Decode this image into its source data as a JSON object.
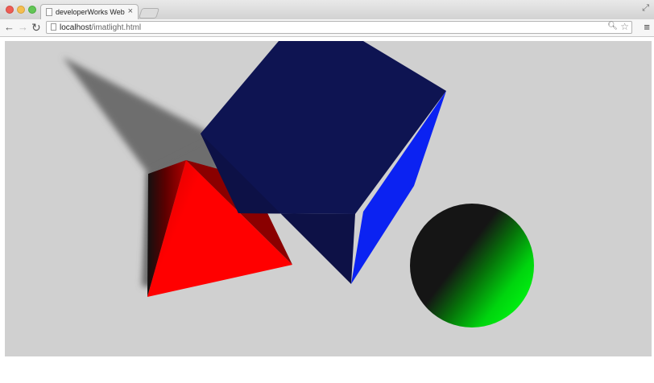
{
  "window": {
    "tab_title": "developerWorks WebGL Th",
    "tab_close_glyph": "×"
  },
  "toolbar": {
    "url_host": "localhost",
    "url_path": "/imatlight.html"
  },
  "scene": {
    "background_color": "#d0d0d0",
    "shadow_color": "#6e6e6e",
    "pyramid_color": "#ff0000",
    "cube_color": "#0e1452",
    "cube_lit_color": "#0b22f2",
    "sphere_color": "#00e60f"
  }
}
